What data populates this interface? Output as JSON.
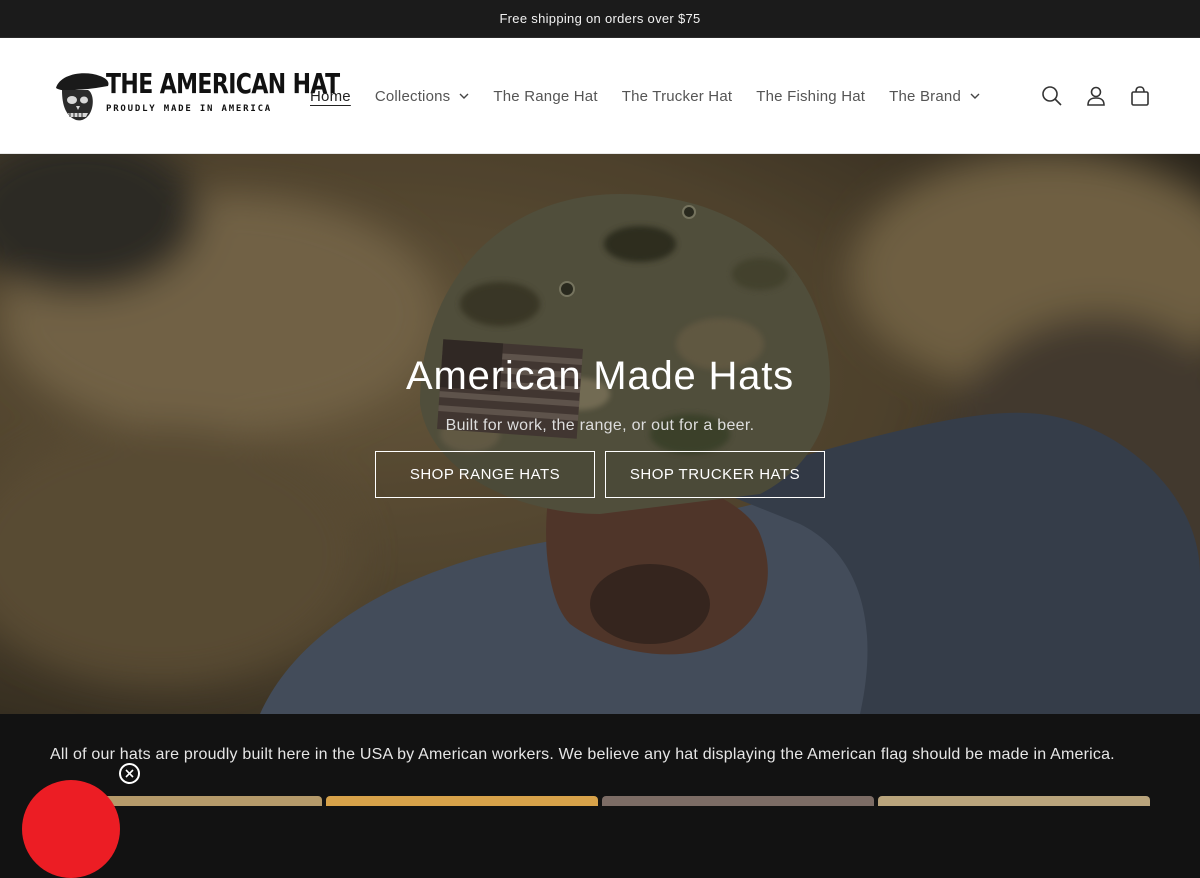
{
  "announcement": {
    "text": "Free shipping on orders over $75"
  },
  "brand": {
    "logo_main": "THE AMERICAN HAT",
    "logo_sub": "PROUDLY MADE IN AMERICA"
  },
  "nav": {
    "items": [
      {
        "label": "Home",
        "active": true
      },
      {
        "label": "Collections",
        "dropdown": true
      },
      {
        "label": "The Range Hat"
      },
      {
        "label": "The Trucker Hat"
      },
      {
        "label": "The Fishing Hat"
      },
      {
        "label": "The Brand",
        "dropdown": true
      }
    ]
  },
  "header_icons": [
    "search-icon",
    "account-icon",
    "cart-icon"
  ],
  "hero": {
    "title": "American Made Hats",
    "subtitle": "Built for work, the range, or out for a beer.",
    "buttons": [
      "SHOP RANGE HATS",
      "SHOP TRUCKER HATS"
    ]
  },
  "intro": {
    "text": "All of our hats are proudly built here in the USA by American workers. We believe any hat displaying the American flag should be made in America."
  },
  "colors": {
    "announcement_bg": "#1b1b1b",
    "header_bg": "#ffffff",
    "page_dark_bg": "#121212",
    "promo_accent": "#ec1d24"
  }
}
